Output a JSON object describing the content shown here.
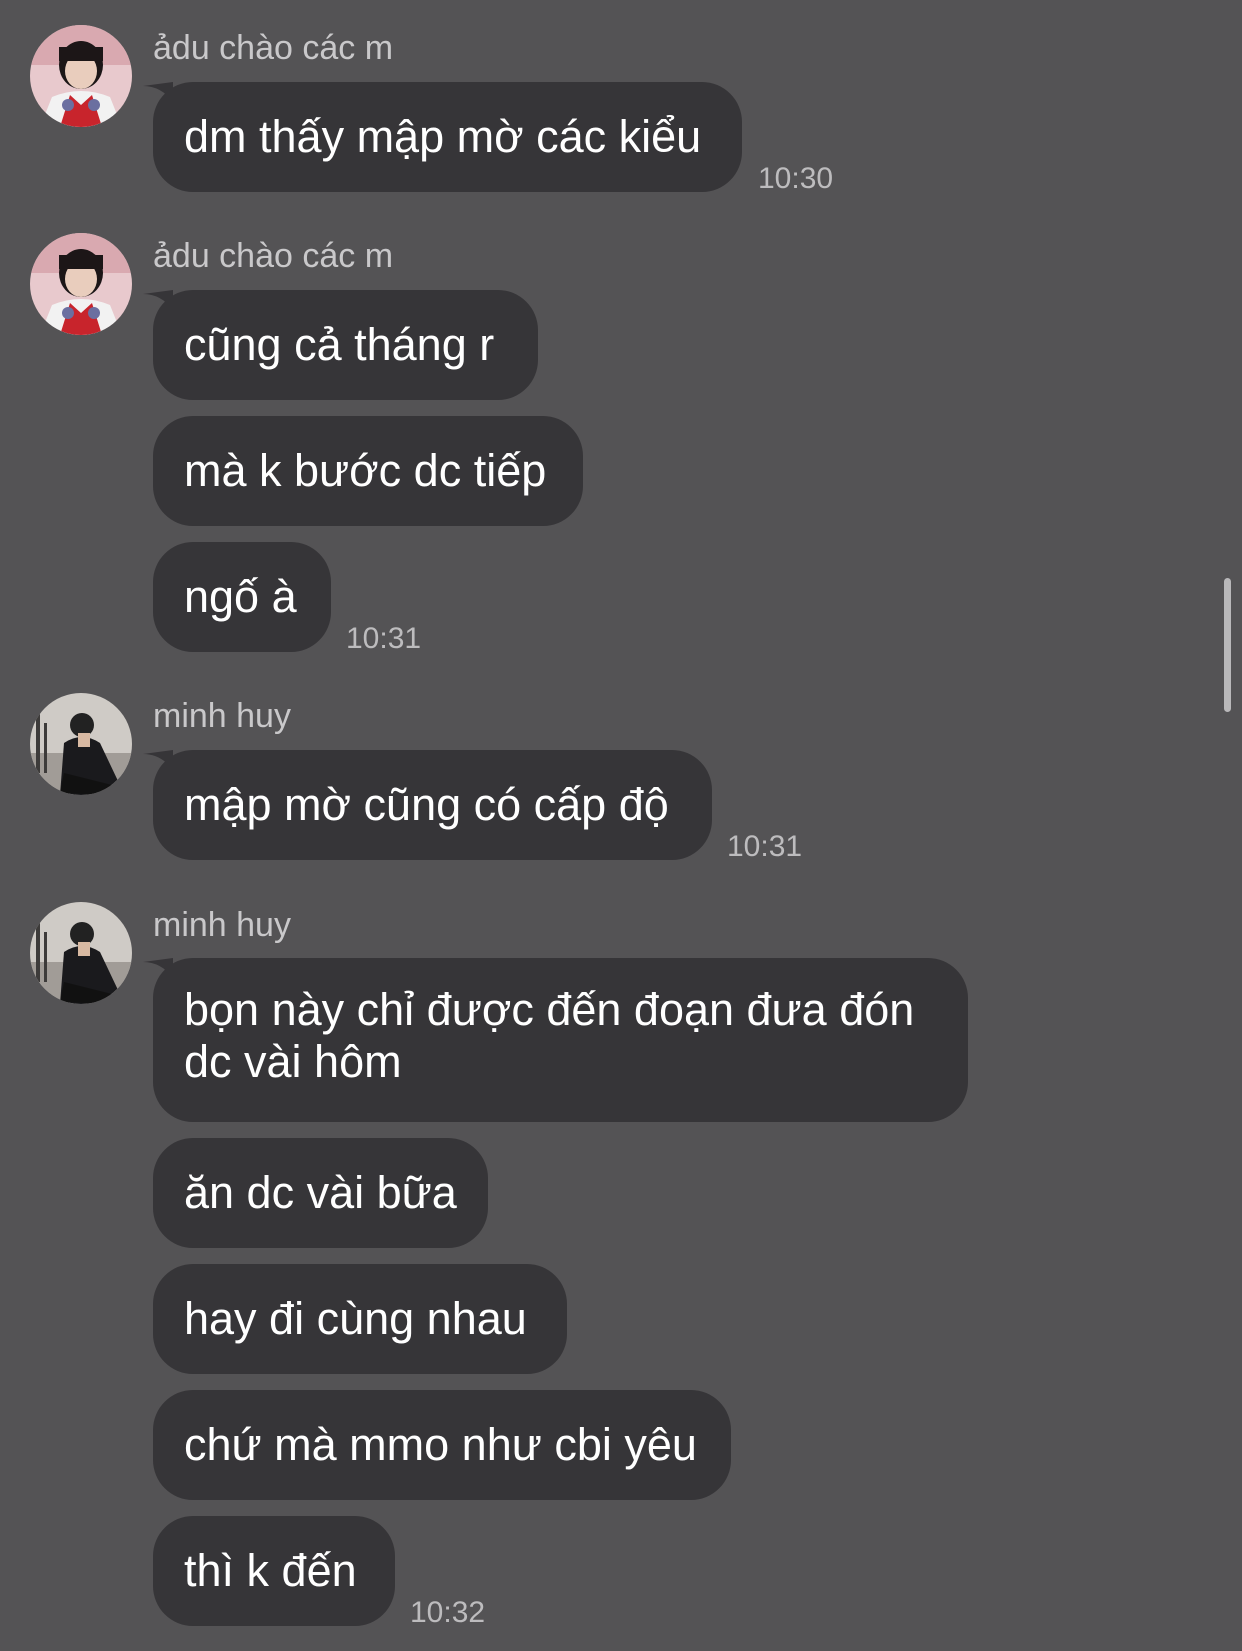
{
  "colors": {
    "background": "#545355",
    "bubble": "#363538",
    "sender": "#c9c8ca",
    "timestamp": "#bdbcbe"
  },
  "groups": [
    {
      "sender": "ảdu chào các m",
      "avatar_icon": "user-avatar-icon",
      "messages": [
        "dm thấy mập mờ các kiểu"
      ],
      "time": "10:30"
    },
    {
      "sender": "ảdu chào các m",
      "avatar_icon": "user-avatar-icon",
      "messages": [
        "cũng cả tháng r",
        "mà k bước dc tiếp",
        "ngố à"
      ],
      "time": "10:31"
    },
    {
      "sender": "minh huy",
      "avatar_icon": "user-avatar-icon",
      "messages": [
        "mập mờ cũng có cấp độ"
      ],
      "time": "10:31"
    },
    {
      "sender": "minh huy",
      "avatar_icon": "user-avatar-icon",
      "messages": [
        "bọn này chỉ được đến đoạn đưa đón dc vài hôm",
        "ăn dc vài bữa",
        "hay đi cùng nhau",
        "chứ mà mmo như cbi yêu",
        "thì k đến"
      ],
      "time": "10:32"
    }
  ]
}
